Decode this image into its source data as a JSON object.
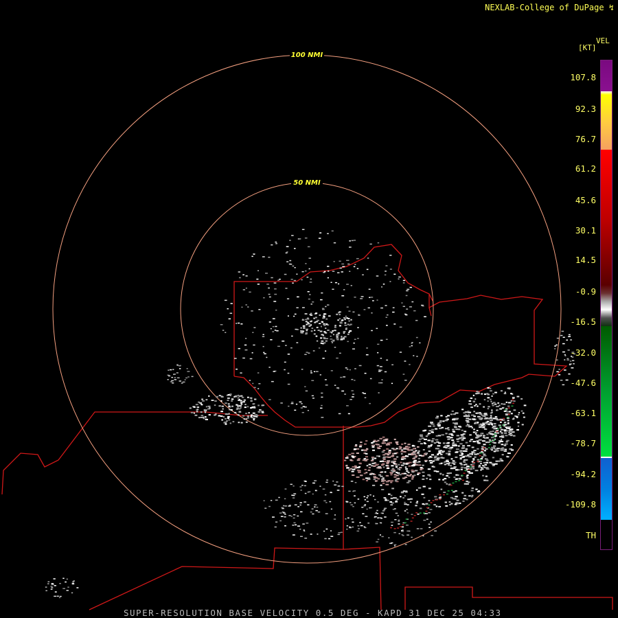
{
  "credit": "NEXLAB-College of DuPage ↯",
  "caption": "SUPER-RESOLUTION BASE VELOCITY 0.5 DEG - KAPD 31 DEC 25 04:33",
  "rings": {
    "outer_label": "100 NMI",
    "inner_label": "50 NMI",
    "color": "#f5a080"
  },
  "legend": {
    "product": "VEL",
    "unit": "[KT]",
    "labels": [
      "107.8",
      "92.3",
      "76.7",
      "61.2",
      "45.6",
      "30.1",
      "14.5",
      "-0.9",
      "-16.5",
      "-32.0",
      "-47.6",
      "-63.1",
      "-78.7",
      "-94.2",
      "-109.8",
      "TH"
    ],
    "colors": {
      "purple": "#7a0a80",
      "yellow": "#ffff00",
      "orange": "#f5a060",
      "red": "#ff0000",
      "dark_red": "#5a0000",
      "gray": "#aaaaaa",
      "dark_green": "#005a00",
      "green": "#00e040",
      "blue": "#1060d0",
      "light_blue": "#00b0ff",
      "black": "#000000"
    }
  },
  "border_color": "#d01818"
}
